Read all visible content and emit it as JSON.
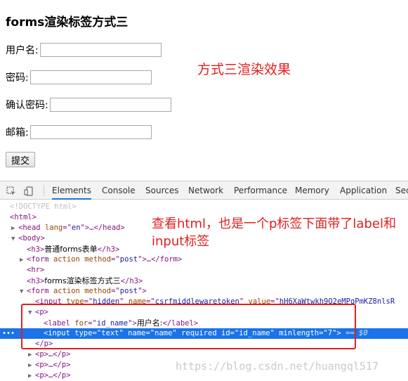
{
  "page": {
    "title": "forms渲染标签方式三",
    "fields": [
      {
        "label": "用户名:",
        "value": ""
      },
      {
        "label": "密码:",
        "value": ""
      },
      {
        "label": "确认密码:",
        "value": ""
      },
      {
        "label": "邮箱:",
        "value": ""
      }
    ],
    "submit_label": "提交"
  },
  "annotations": {
    "render_effect": "方式三渲染效果",
    "inspect_note": "查看html，也是一个p标签下面带了label和input标签"
  },
  "devtools": {
    "tabs": [
      "Elements",
      "Console",
      "Sources",
      "Network",
      "Performance",
      "Memory",
      "Application",
      "Sec"
    ],
    "active_tab": "Elements",
    "tree": {
      "doctype": "<!DOCTYPE html>",
      "html_tag": "html",
      "head": {
        "tag": "head",
        "attr": "lang",
        "val": "en",
        "collapsed": "…</head>"
      },
      "body_tag": "body",
      "h3_1_text": "普通forms表单",
      "form_1": {
        "tag": "form",
        "attr": "action method",
        "val": "post",
        "collapsed": "…</form>"
      },
      "hr_tag": "hr",
      "h3_2_text": "forms渲染标签方式三",
      "form_2": {
        "tag": "form",
        "attr": "action method",
        "val": "post"
      },
      "hidden_input": {
        "type": "hidden",
        "name": "csrfmiddlewaretoken",
        "value": "hH6XaWtwkh9O2eMPgPmKZ8nlsR"
      },
      "p_tag": "p",
      "label": {
        "for": "id_name",
        "text": "用户名:"
      },
      "input": {
        "type": "text",
        "name": "name",
        "required": "required",
        "id": "id_name",
        "minlength": "7",
        "suffix": "== $0"
      },
      "p_close": "/p",
      "collapsed_p": "<p>…</p>"
    }
  },
  "watermark": "https://blog.csdn.net/huangql517"
}
